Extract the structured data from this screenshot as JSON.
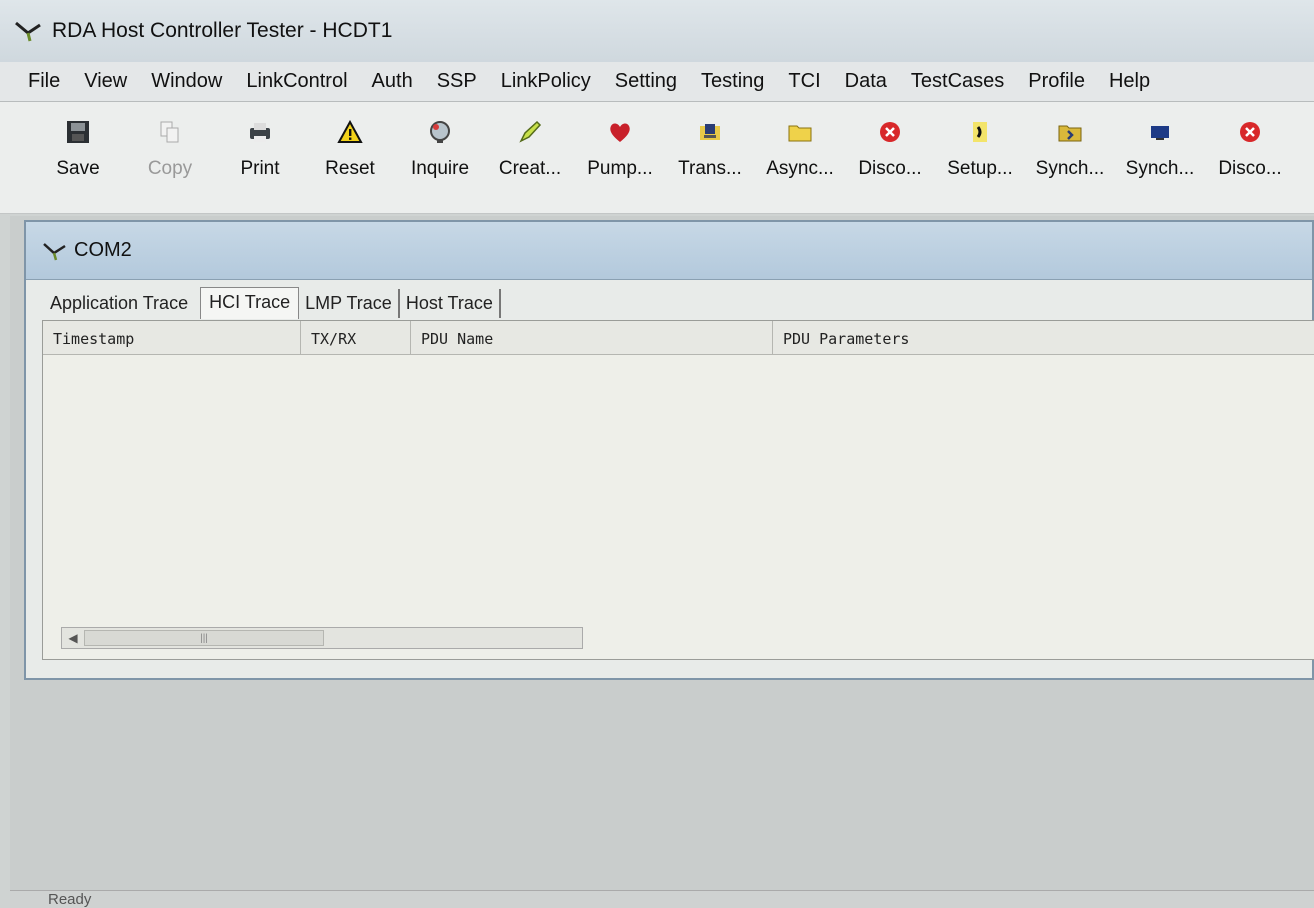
{
  "window": {
    "title": "RDA Host Controller Tester - HCDT1"
  },
  "menu": {
    "items": [
      "File",
      "View",
      "Window",
      "LinkControl",
      "Auth",
      "SSP",
      "LinkPolicy",
      "Setting",
      "Testing",
      "TCI",
      "Data",
      "TestCases",
      "Profile",
      "Help"
    ]
  },
  "toolbar": {
    "buttons": [
      {
        "label": "Save",
        "icon": "floppy-icon",
        "enabled": true
      },
      {
        "label": "Copy",
        "icon": "copy-icon",
        "enabled": false
      },
      {
        "label": "Print",
        "icon": "printer-icon",
        "enabled": true
      },
      {
        "label": "Reset",
        "icon": "warning-icon",
        "enabled": true
      },
      {
        "label": "Inquire",
        "icon": "globe-icon",
        "enabled": true
      },
      {
        "label": "Creat...",
        "icon": "pen-icon",
        "enabled": true
      },
      {
        "label": "Pump...",
        "icon": "heart-icon",
        "enabled": true
      },
      {
        "label": "Trans...",
        "icon": "folder-computer-icon",
        "enabled": true
      },
      {
        "label": "Async...",
        "icon": "folder-icon",
        "enabled": true
      },
      {
        "label": "Disco...",
        "icon": "red-x-icon",
        "enabled": true
      },
      {
        "label": "Setup...",
        "icon": "phone-icon",
        "enabled": true
      },
      {
        "label": "Synch...",
        "icon": "folder-arrow-icon",
        "enabled": true
      },
      {
        "label": "Synch...",
        "icon": "monitor-icon",
        "enabled": true
      },
      {
        "label": "Disco...",
        "icon": "red-x-icon",
        "enabled": true
      }
    ]
  },
  "child_window": {
    "title": "COM2",
    "tabs": [
      "Application Trace",
      "HCI Trace",
      "LMP Trace",
      "Host Trace"
    ],
    "active_tab": "HCI Trace",
    "columns": [
      "Timestamp",
      "TX/RX",
      "PDU Name",
      "PDU Parameters"
    ]
  },
  "status": {
    "text": "Ready"
  },
  "colors": {
    "title_bar": "#cfd8de",
    "child_title": "#b3c9dc",
    "list_bg": "#eeefe9"
  }
}
